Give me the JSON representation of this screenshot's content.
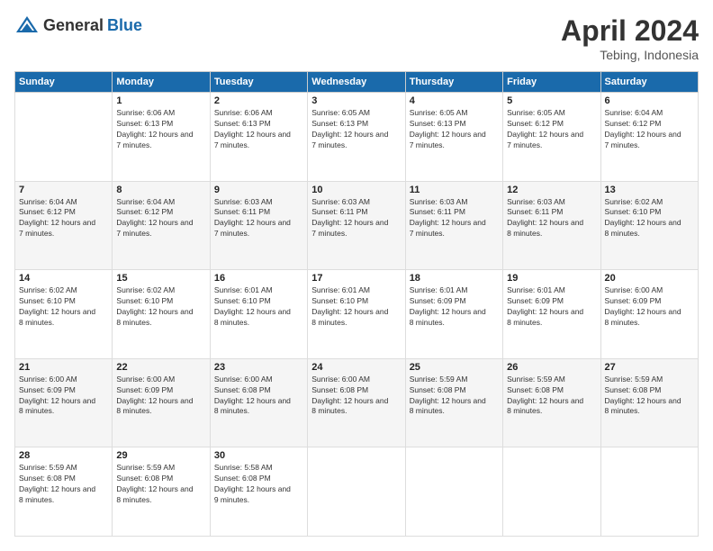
{
  "header": {
    "logo_general": "General",
    "logo_blue": "Blue",
    "month_title": "April 2024",
    "location": "Tebing, Indonesia"
  },
  "weekdays": [
    "Sunday",
    "Monday",
    "Tuesday",
    "Wednesday",
    "Thursday",
    "Friday",
    "Saturday"
  ],
  "weeks": [
    [
      {
        "day": "",
        "sunrise": "",
        "sunset": "",
        "daylight": ""
      },
      {
        "day": "1",
        "sunrise": "Sunrise: 6:06 AM",
        "sunset": "Sunset: 6:13 PM",
        "daylight": "Daylight: 12 hours and 7 minutes."
      },
      {
        "day": "2",
        "sunrise": "Sunrise: 6:06 AM",
        "sunset": "Sunset: 6:13 PM",
        "daylight": "Daylight: 12 hours and 7 minutes."
      },
      {
        "day": "3",
        "sunrise": "Sunrise: 6:05 AM",
        "sunset": "Sunset: 6:13 PM",
        "daylight": "Daylight: 12 hours and 7 minutes."
      },
      {
        "day": "4",
        "sunrise": "Sunrise: 6:05 AM",
        "sunset": "Sunset: 6:13 PM",
        "daylight": "Daylight: 12 hours and 7 minutes."
      },
      {
        "day": "5",
        "sunrise": "Sunrise: 6:05 AM",
        "sunset": "Sunset: 6:12 PM",
        "daylight": "Daylight: 12 hours and 7 minutes."
      },
      {
        "day": "6",
        "sunrise": "Sunrise: 6:04 AM",
        "sunset": "Sunset: 6:12 PM",
        "daylight": "Daylight: 12 hours and 7 minutes."
      }
    ],
    [
      {
        "day": "7",
        "sunrise": "Sunrise: 6:04 AM",
        "sunset": "Sunset: 6:12 PM",
        "daylight": "Daylight: 12 hours and 7 minutes."
      },
      {
        "day": "8",
        "sunrise": "Sunrise: 6:04 AM",
        "sunset": "Sunset: 6:12 PM",
        "daylight": "Daylight: 12 hours and 7 minutes."
      },
      {
        "day": "9",
        "sunrise": "Sunrise: 6:03 AM",
        "sunset": "Sunset: 6:11 PM",
        "daylight": "Daylight: 12 hours and 7 minutes."
      },
      {
        "day": "10",
        "sunrise": "Sunrise: 6:03 AM",
        "sunset": "Sunset: 6:11 PM",
        "daylight": "Daylight: 12 hours and 7 minutes."
      },
      {
        "day": "11",
        "sunrise": "Sunrise: 6:03 AM",
        "sunset": "Sunset: 6:11 PM",
        "daylight": "Daylight: 12 hours and 7 minutes."
      },
      {
        "day": "12",
        "sunrise": "Sunrise: 6:03 AM",
        "sunset": "Sunset: 6:11 PM",
        "daylight": "Daylight: 12 hours and 8 minutes."
      },
      {
        "day": "13",
        "sunrise": "Sunrise: 6:02 AM",
        "sunset": "Sunset: 6:10 PM",
        "daylight": "Daylight: 12 hours and 8 minutes."
      }
    ],
    [
      {
        "day": "14",
        "sunrise": "Sunrise: 6:02 AM",
        "sunset": "Sunset: 6:10 PM",
        "daylight": "Daylight: 12 hours and 8 minutes."
      },
      {
        "day": "15",
        "sunrise": "Sunrise: 6:02 AM",
        "sunset": "Sunset: 6:10 PM",
        "daylight": "Daylight: 12 hours and 8 minutes."
      },
      {
        "day": "16",
        "sunrise": "Sunrise: 6:01 AM",
        "sunset": "Sunset: 6:10 PM",
        "daylight": "Daylight: 12 hours and 8 minutes."
      },
      {
        "day": "17",
        "sunrise": "Sunrise: 6:01 AM",
        "sunset": "Sunset: 6:10 PM",
        "daylight": "Daylight: 12 hours and 8 minutes."
      },
      {
        "day": "18",
        "sunrise": "Sunrise: 6:01 AM",
        "sunset": "Sunset: 6:09 PM",
        "daylight": "Daylight: 12 hours and 8 minutes."
      },
      {
        "day": "19",
        "sunrise": "Sunrise: 6:01 AM",
        "sunset": "Sunset: 6:09 PM",
        "daylight": "Daylight: 12 hours and 8 minutes."
      },
      {
        "day": "20",
        "sunrise": "Sunrise: 6:00 AM",
        "sunset": "Sunset: 6:09 PM",
        "daylight": "Daylight: 12 hours and 8 minutes."
      }
    ],
    [
      {
        "day": "21",
        "sunrise": "Sunrise: 6:00 AM",
        "sunset": "Sunset: 6:09 PM",
        "daylight": "Daylight: 12 hours and 8 minutes."
      },
      {
        "day": "22",
        "sunrise": "Sunrise: 6:00 AM",
        "sunset": "Sunset: 6:09 PM",
        "daylight": "Daylight: 12 hours and 8 minutes."
      },
      {
        "day": "23",
        "sunrise": "Sunrise: 6:00 AM",
        "sunset": "Sunset: 6:08 PM",
        "daylight": "Daylight: 12 hours and 8 minutes."
      },
      {
        "day": "24",
        "sunrise": "Sunrise: 6:00 AM",
        "sunset": "Sunset: 6:08 PM",
        "daylight": "Daylight: 12 hours and 8 minutes."
      },
      {
        "day": "25",
        "sunrise": "Sunrise: 5:59 AM",
        "sunset": "Sunset: 6:08 PM",
        "daylight": "Daylight: 12 hours and 8 minutes."
      },
      {
        "day": "26",
        "sunrise": "Sunrise: 5:59 AM",
        "sunset": "Sunset: 6:08 PM",
        "daylight": "Daylight: 12 hours and 8 minutes."
      },
      {
        "day": "27",
        "sunrise": "Sunrise: 5:59 AM",
        "sunset": "Sunset: 6:08 PM",
        "daylight": "Daylight: 12 hours and 8 minutes."
      }
    ],
    [
      {
        "day": "28",
        "sunrise": "Sunrise: 5:59 AM",
        "sunset": "Sunset: 6:08 PM",
        "daylight": "Daylight: 12 hours and 8 minutes."
      },
      {
        "day": "29",
        "sunrise": "Sunrise: 5:59 AM",
        "sunset": "Sunset: 6:08 PM",
        "daylight": "Daylight: 12 hours and 8 minutes."
      },
      {
        "day": "30",
        "sunrise": "Sunrise: 5:58 AM",
        "sunset": "Sunset: 6:08 PM",
        "daylight": "Daylight: 12 hours and 9 minutes."
      },
      {
        "day": "",
        "sunrise": "",
        "sunset": "",
        "daylight": ""
      },
      {
        "day": "",
        "sunrise": "",
        "sunset": "",
        "daylight": ""
      },
      {
        "day": "",
        "sunrise": "",
        "sunset": "",
        "daylight": ""
      },
      {
        "day": "",
        "sunrise": "",
        "sunset": "",
        "daylight": ""
      }
    ]
  ]
}
